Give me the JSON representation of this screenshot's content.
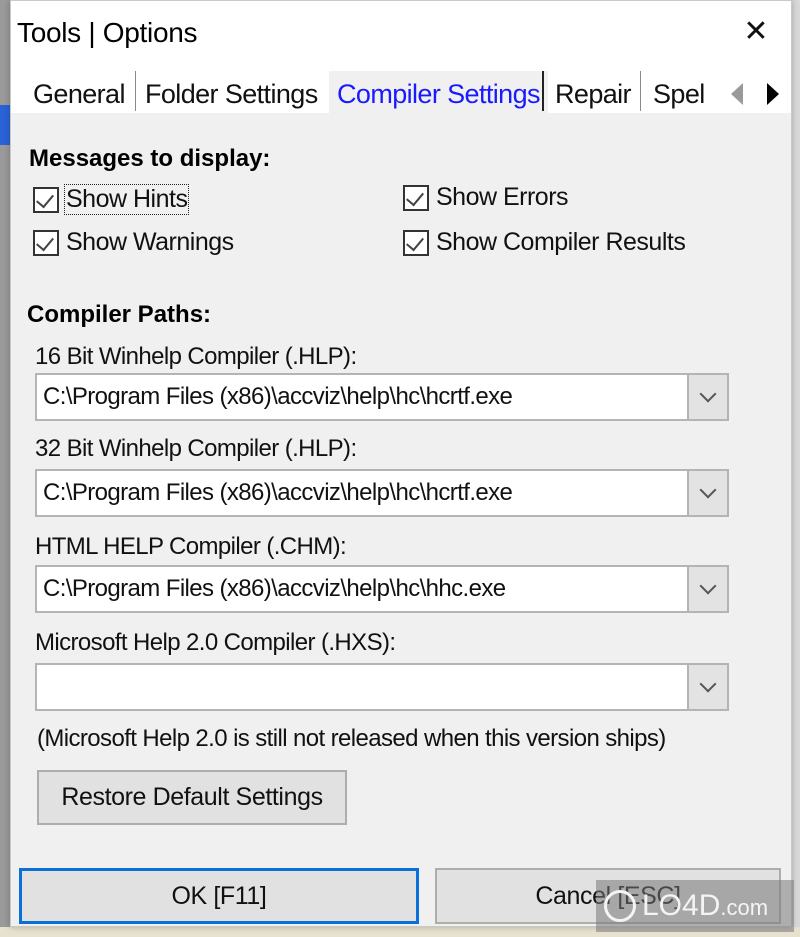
{
  "window": {
    "title": "Tools | Options",
    "close_label": "✕"
  },
  "tabs": [
    {
      "label": "General",
      "active": false
    },
    {
      "label": "Folder Settings",
      "active": false
    },
    {
      "label": "Compiler Settings",
      "active": true
    },
    {
      "label": "Repair",
      "active": false
    },
    {
      "label": "Spel",
      "active": false
    }
  ],
  "messages": {
    "title": "Messages to display:",
    "checkboxes": [
      {
        "label": "Show Hints",
        "checked": true,
        "focused": true
      },
      {
        "label": "Show Errors",
        "checked": true,
        "focused": false
      },
      {
        "label": "Show Warnings",
        "checked": true,
        "focused": false
      },
      {
        "label": "Show Compiler Results",
        "checked": true,
        "focused": false
      }
    ]
  },
  "compiler_paths": {
    "title": "Compiler Paths:",
    "fields": [
      {
        "label": "16 Bit Winhelp Compiler (.HLP):",
        "value": "C:\\Program Files (x86)\\accviz\\help\\hc\\hcrtf.exe"
      },
      {
        "label": "32 Bit Winhelp Compiler (.HLP):",
        "value": "C:\\Program Files (x86)\\accviz\\help\\hc\\hcrtf.exe"
      },
      {
        "label": "HTML HELP Compiler (.CHM):",
        "value": "C:\\Program Files (x86)\\accviz\\help\\hc\\hhc.exe"
      },
      {
        "label": "Microsoft Help 2.0 Compiler (.HXS):",
        "value": ""
      }
    ],
    "note": "(Microsoft Help 2.0 is still not released when this version ships)"
  },
  "buttons": {
    "restore": "Restore Default Settings",
    "ok": "OK [F11]",
    "cancel": "Cancel [ESC]"
  },
  "watermark": {
    "text": "LO4D",
    "suffix": ".com"
  }
}
